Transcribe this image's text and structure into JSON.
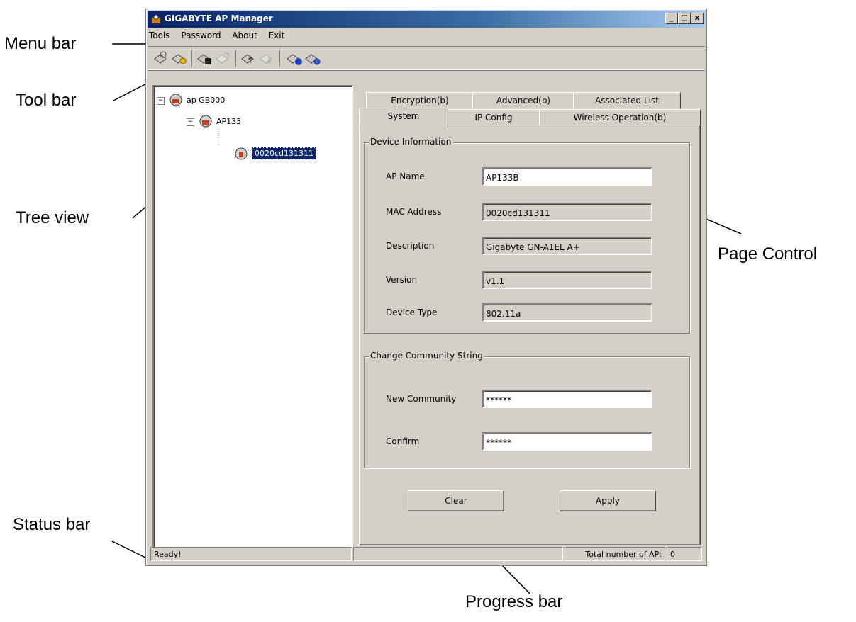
{
  "window": {
    "title": "GIGABYTE AP Manager",
    "minimize": "_",
    "maximize": "□",
    "close": "x"
  },
  "menu": {
    "items": [
      {
        "name": "tools",
        "label": "Tools"
      },
      {
        "name": "password",
        "label": "Password"
      },
      {
        "name": "about",
        "label": "About"
      },
      {
        "name": "exit",
        "label": "Exit"
      }
    ]
  },
  "toolbar": {
    "buttons": [
      "scan-icon",
      "key-icon",
      "save-icon",
      "load-icon",
      "upload-icon",
      "download-icon",
      "add-icon",
      "settings-icon"
    ]
  },
  "tree": {
    "root": "ap  GB000",
    "group": "AP133",
    "device": "0020cd131311",
    "expander": "−"
  },
  "tabs": {
    "row_back": [
      "Encryption(b)",
      "Advanced(b)",
      "Associated List"
    ],
    "row_front": [
      "System",
      "IP Config",
      "Wireless Operation(b)"
    ],
    "active": "System"
  },
  "device_info": {
    "legend": "Device Information",
    "ap_name_label": "AP Name",
    "ap_name": "AP133B",
    "mac_label": "MAC Address",
    "mac": "0020cd131311",
    "description_label": "Description",
    "description": "Gigabyte GN-A1EL A+",
    "version_label": "Version",
    "version": "v1.1",
    "device_type_label": "Device Type",
    "device_type": "802.11a"
  },
  "community": {
    "legend": "Change Community String",
    "new_label": "New Community",
    "new_value": "******",
    "confirm_label": "Confirm",
    "confirm_value": "******"
  },
  "buttons": {
    "clear": "Clear",
    "apply": "Apply"
  },
  "status": {
    "ready": "Ready!",
    "total_label": "Total number of AP:",
    "total_value": "0"
  },
  "annotations": {
    "menu_bar": "Menu bar",
    "tool_bar": "Tool bar",
    "tree_view": "Tree view",
    "page_control": "Page Control",
    "status_bar": "Status bar",
    "progress_bar": "Progress bar"
  }
}
